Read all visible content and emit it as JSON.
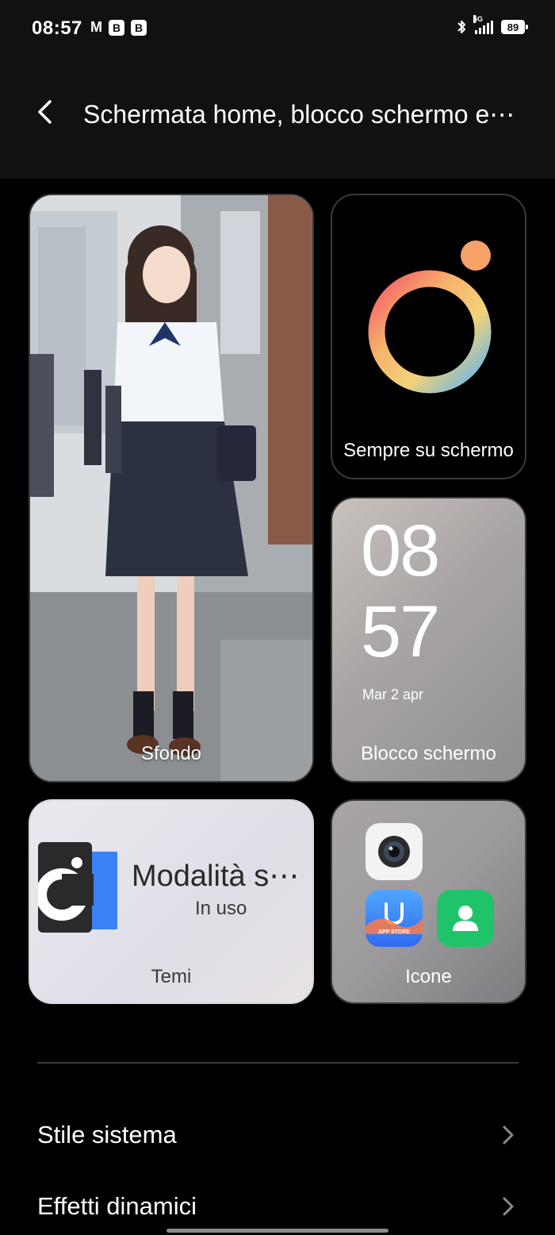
{
  "status_bar": {
    "time": "08:57",
    "gmail_icon": "M",
    "app_icon_1": "B",
    "app_icon_2": "B",
    "network": "5G",
    "battery": "89"
  },
  "header": {
    "title": "Schermata home, blocco schermo e⋯"
  },
  "cards": {
    "wallpaper": {
      "label": "Sfondo"
    },
    "aod": {
      "label": "Sempre su schermo"
    },
    "lockscreen": {
      "label": "Blocco schermo",
      "hour": "08",
      "minute": "57",
      "date": "Mar 2 apr"
    },
    "themes": {
      "label": "Temi",
      "theme_name": "Modalità s⋯",
      "status": "In uso"
    },
    "icons": {
      "label": "Icone",
      "app_store_text": "APP STORE"
    }
  },
  "menu": [
    {
      "label": "Stile sistema"
    },
    {
      "label": "Effetti dinamici"
    }
  ],
  "colors": {
    "background": "#000000",
    "header_bg": "#111111",
    "aod_accent": "#f6a268",
    "contacts_green": "#1fc46a",
    "appstore_blue": "#2f8cf5"
  }
}
